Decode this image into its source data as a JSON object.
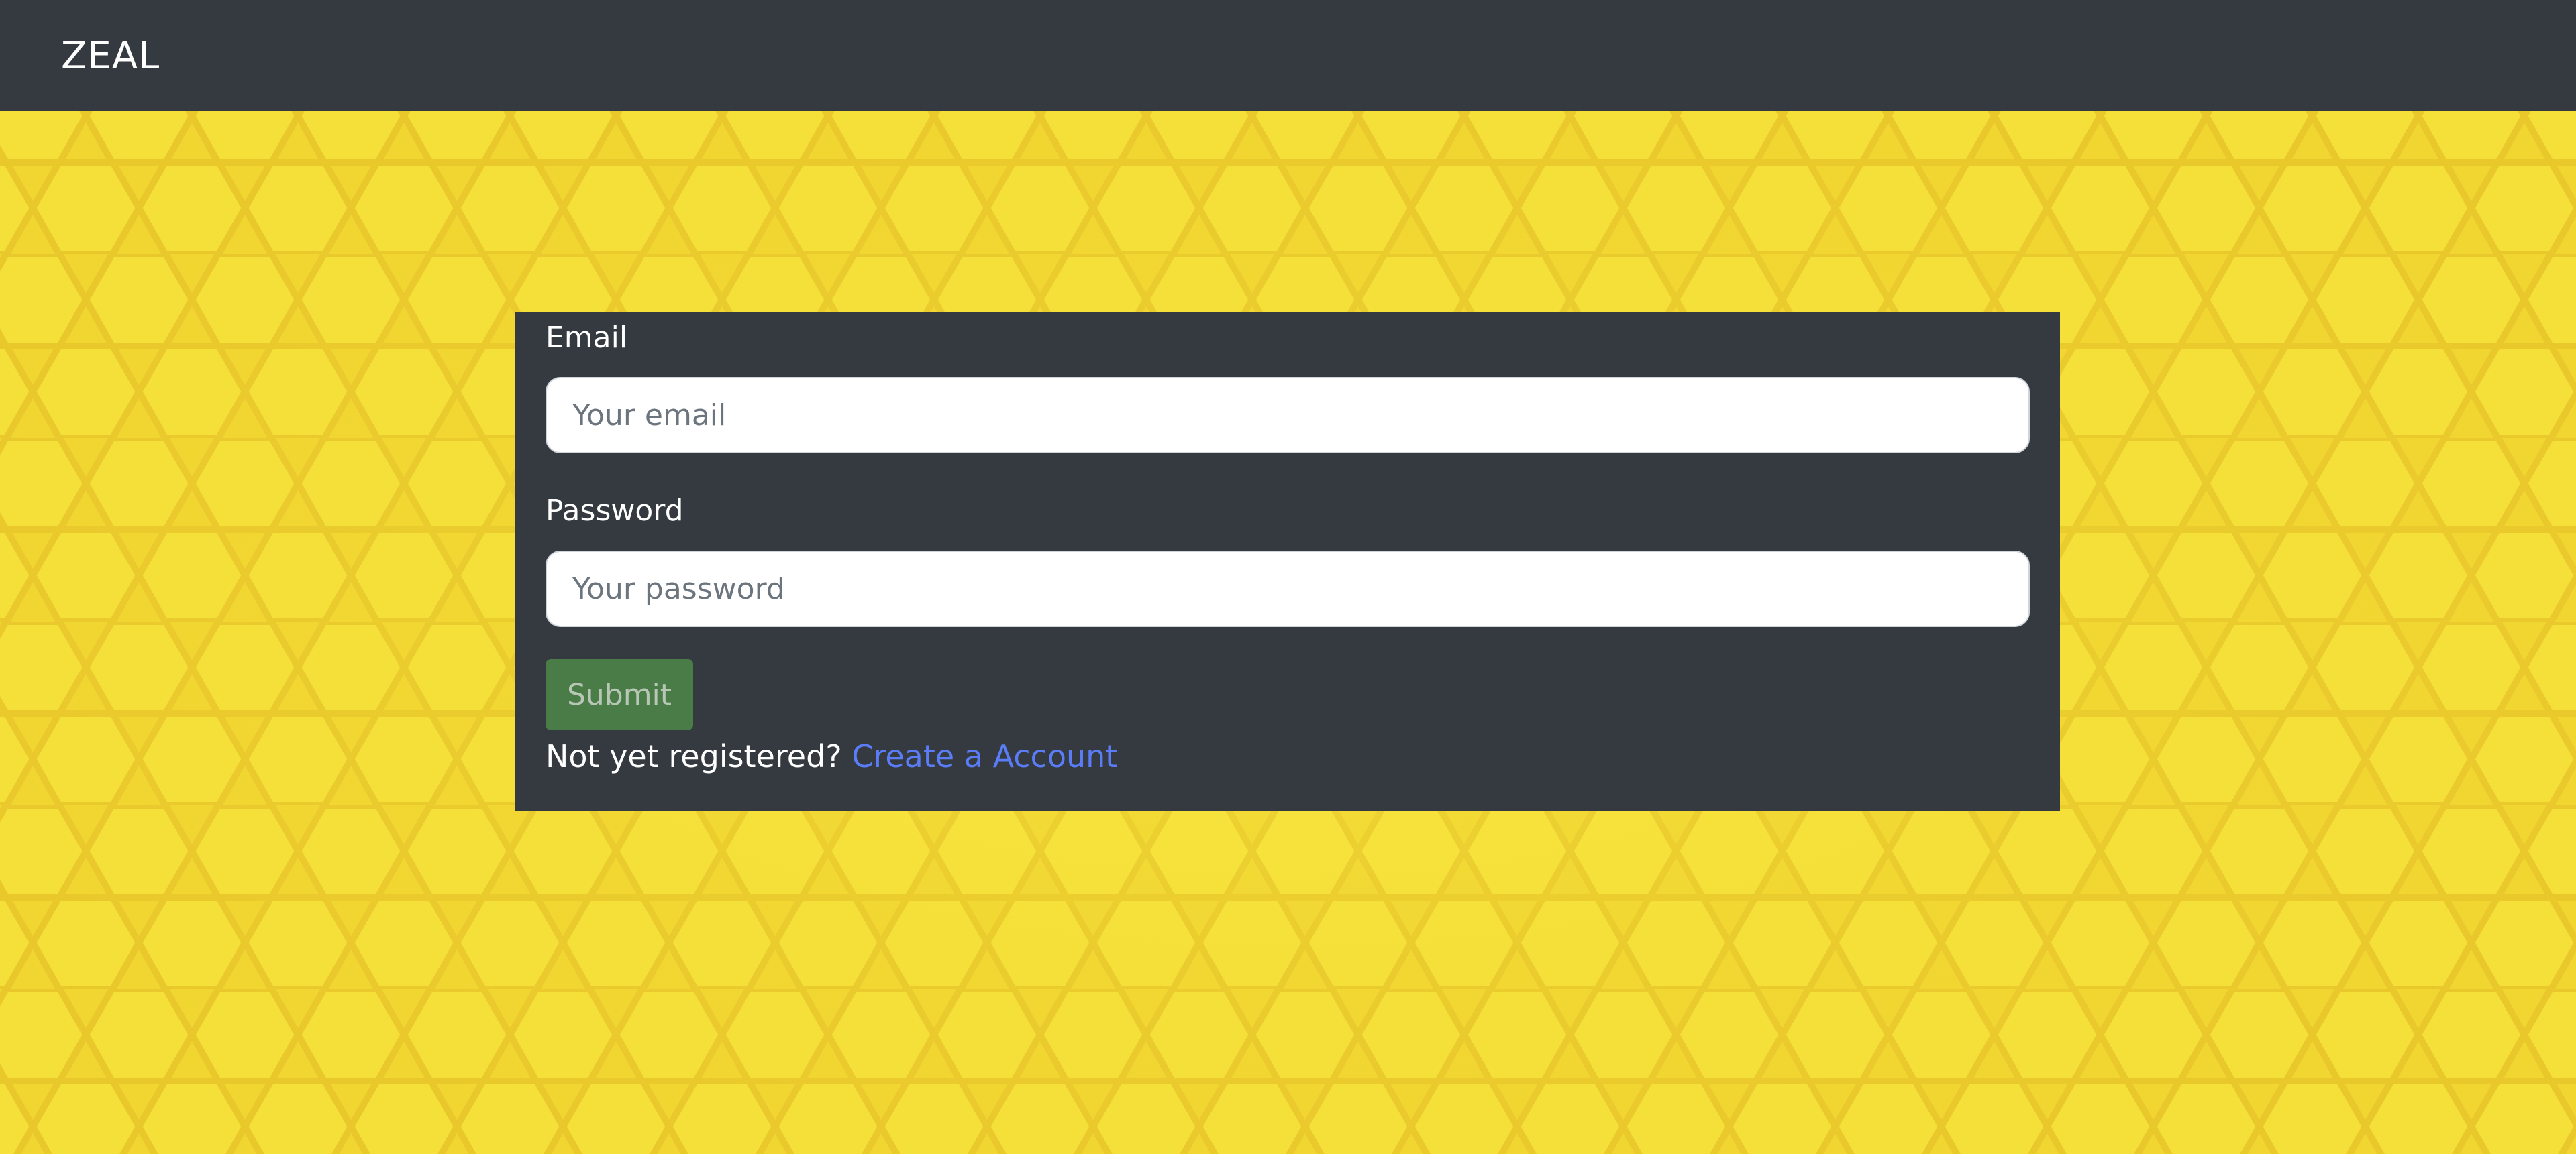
{
  "navbar": {
    "brand": "ZEAL"
  },
  "theme": {
    "navbar_bg": "#343a40",
    "card_bg": "#343a40",
    "page_bg": "#f1d531",
    "submit_bg": "#4a7c48",
    "link_color": "#5b7cf7"
  },
  "login_form": {
    "email_label": "Email",
    "email_placeholder": "Your email",
    "email_value": "",
    "password_label": "Password",
    "password_placeholder": "Your password",
    "password_value": "",
    "submit_label": "Submit",
    "register_prompt": "Not yet registered?",
    "register_link": "Create a Account"
  }
}
